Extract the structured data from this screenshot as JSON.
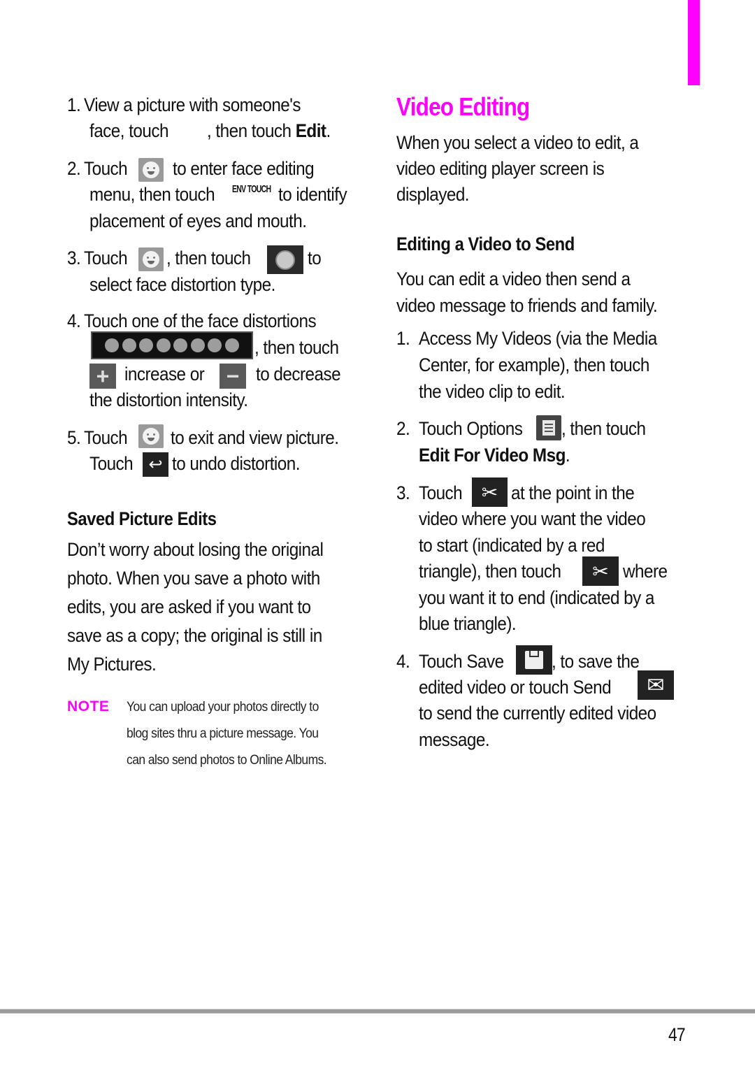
{
  "colors": {
    "accent": "#ff00ff",
    "rule": "#9a9a9a"
  },
  "left": {
    "steps": [
      {
        "n": "1.",
        "l1a": "View a picture with someone's",
        "l2a": "face, touch",
        "l2b": ", then touch ",
        "l2bold": "Edit",
        "l2c": "."
      },
      {
        "n": "2.",
        "l1a": "Touch",
        "l1b": "to enter face editing",
        "l2a": "menu, then touch",
        "l2icon": "ENV TOUCH",
        "l2b": "to identify",
        "l3": "placement of eyes and mouth."
      },
      {
        "n": "3.",
        "l1a": "Touch",
        "l1b": ", then touch",
        "l1c": "to",
        "l2": "select face distortion type."
      },
      {
        "n": "4.",
        "l1a": "Touch one of the face distortions",
        "l2b": ", then touch",
        "l3a": "increase or",
        "l3b": "to decrease",
        "l4": "the distortion intensity."
      },
      {
        "n": "5.",
        "l1a": "Touch",
        "l1b": "to exit and view picture.",
        "l2a": "Touch",
        "l2b": "to undo distortion."
      }
    ],
    "saved_heading": "Saved Picture Edits",
    "saved_body": [
      "Don’t worry about losing the original",
      "photo. When you save a photo with",
      "edits, you are asked if you want to",
      "save as a copy; the original is still in",
      "My Pictures."
    ],
    "note_label": "NOTE",
    "note_lines": [
      "You can upload your photos directly to",
      "blog sites thru a picture message. You",
      "can also send photos to Online Albums."
    ]
  },
  "right": {
    "title": "Video Editing",
    "intro": [
      "When you select a video to edit, a",
      "video editing player screen is",
      "displayed."
    ],
    "sub_heading": "Editing a Video to Send",
    "sub_intro": [
      "You can edit a video then send a",
      "video message to friends and family."
    ],
    "steps": [
      {
        "n": "1.",
        "lines": [
          "Access My Videos (via the Media",
          "Center, for example), then touch",
          "the video clip to edit."
        ]
      },
      {
        "n": "2.",
        "l1a": "Touch Options",
        "l1b": ", then touch",
        "l2bold": "Edit For Video Msg",
        "l2c": "."
      },
      {
        "n": "3.",
        "l1a": "Touch",
        "l1b": "at the point in the",
        "l2": "video where you want the video",
        "l3": "to start (indicated by a red",
        "l4a": "triangle), then touch",
        "l4b": "where",
        "l5": "you want it to end (indicated by a",
        "l6": "blue triangle)."
      },
      {
        "n": "4.",
        "l1a": "Touch Save",
        "l1b": ", to save the",
        "l2a": "edited video or touch Send",
        "l3": "to send the currently edited video",
        "l4": "message."
      }
    ]
  },
  "footer": {
    "page_number": "47"
  }
}
